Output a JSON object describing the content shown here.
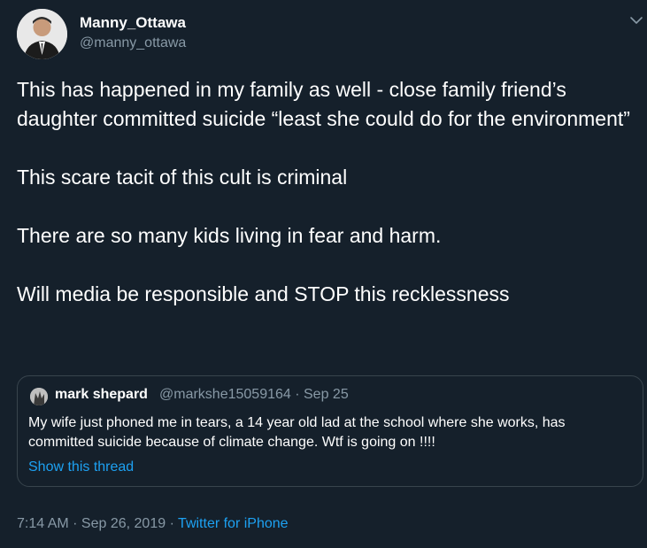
{
  "author": {
    "name": "Manny_Ottawa",
    "handle": "@manny_ottawa",
    "avatar_icon": "profile-photo-icon"
  },
  "tweet": {
    "paragraphs": [
      "This has happened in my family as well - close family friend’s daughter committed suicide “least she could do for the environment”",
      "This scare tacit of this cult is criminal",
      "There are so many kids living in fear and harm.",
      "Will media be responsible and STOP this recklessness"
    ]
  },
  "quoted": {
    "name": "mark shepard",
    "meta": "@markshe15059164 · Sep 25",
    "text": "My wife just phoned me in tears, a 14 year old lad at the school where she works, has committed suicide because of climate change.  Wtf is going on !!!!",
    "thread_link": "Show this thread"
  },
  "footer": {
    "timestamp": "7:14 AM · Sep 26, 2019 · ",
    "source": "Twitter for iPhone"
  },
  "colors": {
    "background": "#15202b",
    "text": "#ffffff",
    "secondary": "#8899a6",
    "link": "#1da1f2",
    "border": "#38444d"
  }
}
